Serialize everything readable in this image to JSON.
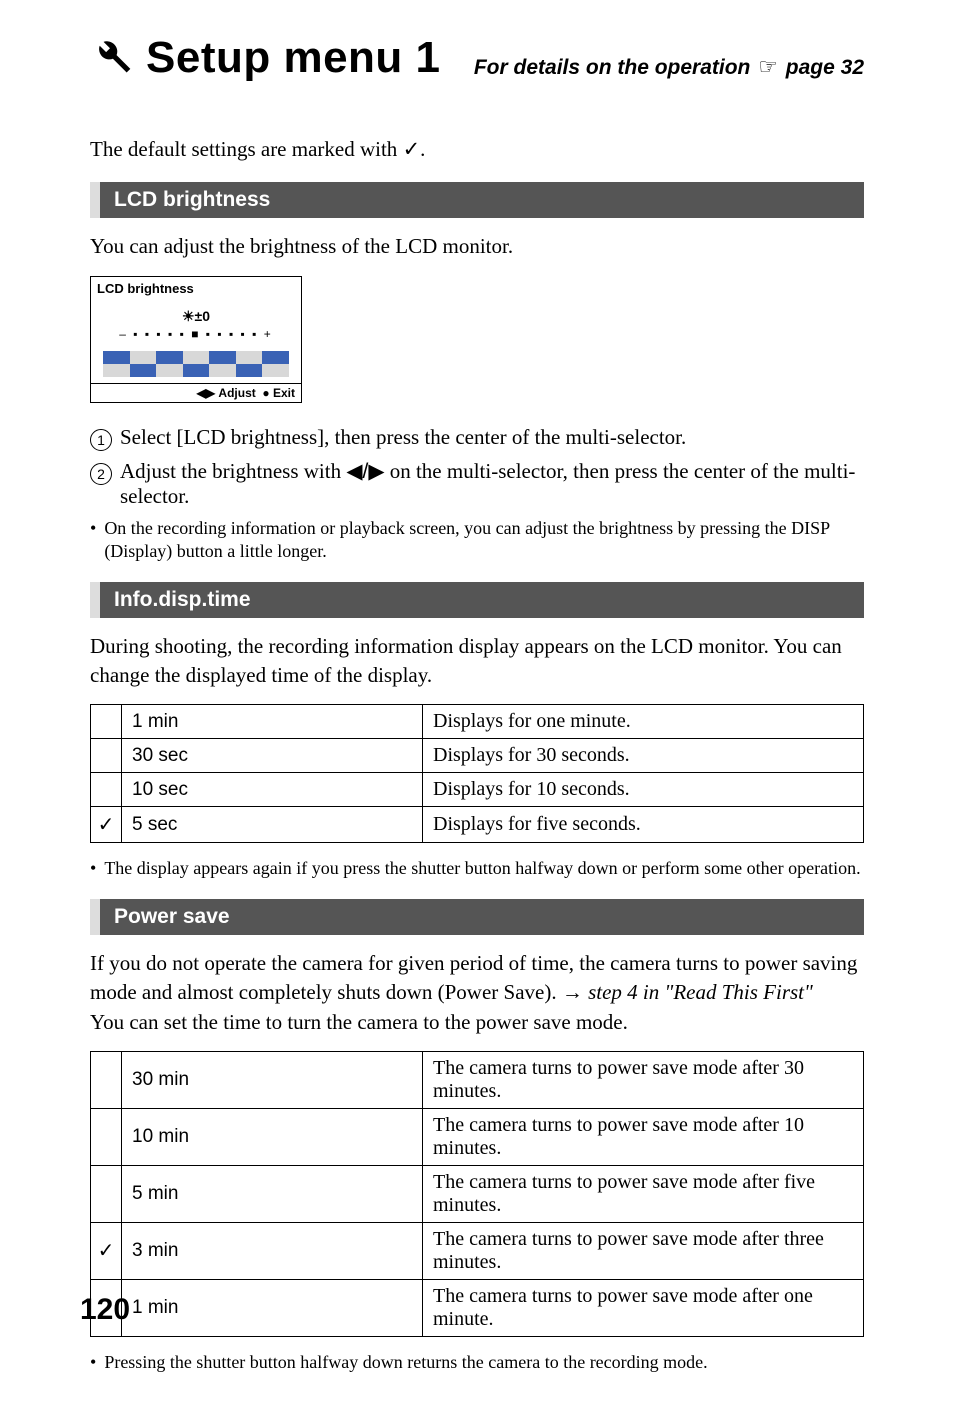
{
  "header": {
    "title": "Setup menu 1",
    "details_prefix": "For details on the operation ",
    "details_suffix": " page 32"
  },
  "intro": "The default settings are marked with ",
  "section1": {
    "heading": "LCD brightness",
    "text": "You can adjust the brightness of the LCD monitor.",
    "lcd_title": "LCD brightness",
    "lcd_value": "±0",
    "lcd_bottom": "Adjust    Exit",
    "step1": "Select [LCD brightness], then press the center of the multi-selector.",
    "step2_a": "Adjust the brightness with ",
    "step2_b": " on the multi-selector, then press the center of the multi-selector.",
    "bullet": "On the recording information or playback screen, you can adjust the brightness by pressing the DISP (Display) button a little longer."
  },
  "section2": {
    "heading": "Info.disp.time",
    "text": "During shooting, the recording information display appears on the LCD monitor. You can change the displayed time of the display.",
    "rows": [
      {
        "chk": "",
        "opt": "1 min",
        "desc": "Displays for one minute."
      },
      {
        "chk": "",
        "opt": "30 sec",
        "desc": "Displays for 30 seconds."
      },
      {
        "chk": "",
        "opt": "10 sec",
        "desc": "Displays for 10 seconds."
      },
      {
        "chk": "✓",
        "opt": "5 sec",
        "desc": "Displays for five seconds."
      }
    ],
    "bullet": "The display appears again if you press the shutter button halfway down or perform some other operation."
  },
  "section3": {
    "heading": "Power save",
    "text_a": "If you do not operate the camera for given period of time, the camera turns to power saving mode and almost completely shuts down (Power Save). ",
    "text_b": " step 4 in \"Read This First\"",
    "text_c": "You can set the time to turn the camera to the power save mode.",
    "rows": [
      {
        "chk": "",
        "opt": "30 min",
        "desc": "The camera turns to power save mode after 30 minutes."
      },
      {
        "chk": "",
        "opt": "10 min",
        "desc": "The camera turns to power save mode after 10 minutes."
      },
      {
        "chk": "",
        "opt": "5 min",
        "desc": "The camera turns to power save mode after five minutes."
      },
      {
        "chk": "✓",
        "opt": "3 min",
        "desc": "The camera turns to power save mode after three minutes."
      },
      {
        "chk": "",
        "opt": "1 min",
        "desc": "The camera turns to power save mode after one minute."
      }
    ],
    "bullet": "Pressing the shutter button halfway down returns the camera to the recording mode."
  },
  "page_number": "120"
}
